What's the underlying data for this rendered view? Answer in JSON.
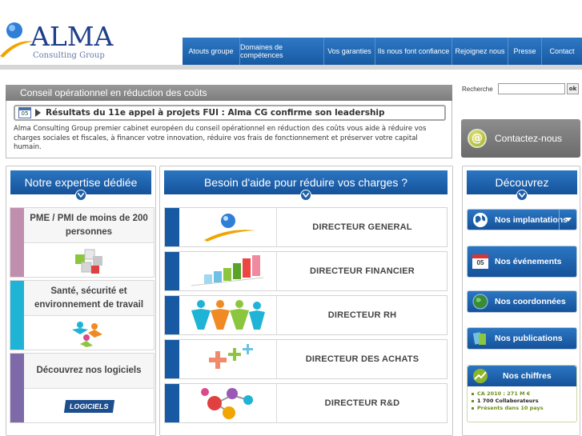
{
  "header": {
    "logo_text": "ALMA",
    "logo_subtitle": "Consulting Group",
    "nav": [
      {
        "label": "Atouts groupe"
      },
      {
        "label": "Domaines de compétences"
      },
      {
        "label": "Vos garanties"
      },
      {
        "label": "Ils nous font confiance"
      },
      {
        "label": "Rejoignez nous"
      },
      {
        "label": "Presse"
      },
      {
        "label": "Contact"
      }
    ]
  },
  "intro": {
    "bar_title": "Conseil opérationnel en réduction des coûts",
    "calendar_day": "05",
    "headline": "Résultats du 11e appel à projets FUI : Alma CG confirme son leadership",
    "description": "Alma Consulting Group premier cabinet européen du conseil opérationnel en réduction des coûts vous aide à réduire vos charges sociales et fiscales, à financer votre innovation, réduire vos frais de fonctionnement et préserver votre capital humain."
  },
  "search": {
    "label": "Recherche",
    "value": "",
    "button": "ok"
  },
  "contact": {
    "label": "Contactez-nous"
  },
  "expertise": {
    "title": "Notre expertise dédiée",
    "items": [
      {
        "label": "PME / PMI de moins de 200 personnes",
        "color": "#c08fae"
      },
      {
        "label": "Santé, sécurité et environnement de travail",
        "color": "#1fb3d6"
      },
      {
        "label": "Découvrez nos logiciels",
        "color": "#7e6aa8",
        "badge": "LOGICIELS"
      }
    ]
  },
  "charges": {
    "title": "Besoin d'aide pour réduire vos charges ?",
    "rows": [
      {
        "label": "DIRECTEUR GENERAL"
      },
      {
        "label": "DIRECTEUR FINANCIER"
      },
      {
        "label": "DIRECTEUR RH"
      },
      {
        "label": "DIRECTEUR DES ACHATS"
      },
      {
        "label": "DIRECTEUR R&D"
      }
    ]
  },
  "discover": {
    "title": "Découvrez",
    "buttons": [
      {
        "label": "Nos implantations"
      },
      {
        "label": "Nos événements",
        "calendar_day": "05"
      },
      {
        "label": "Nos coordonnées"
      },
      {
        "label": "Nos publications"
      }
    ],
    "chiffres": {
      "title": "Nos chiffres",
      "items": [
        "CA 2010 : 271 M €",
        "1 700 Collaborateurs",
        "Présents dans 10 pays"
      ]
    }
  },
  "colors": {
    "brand_blue": "#1f64ae",
    "dark_blue": "#175aa3",
    "grey_bar": "#8a8a8a"
  }
}
